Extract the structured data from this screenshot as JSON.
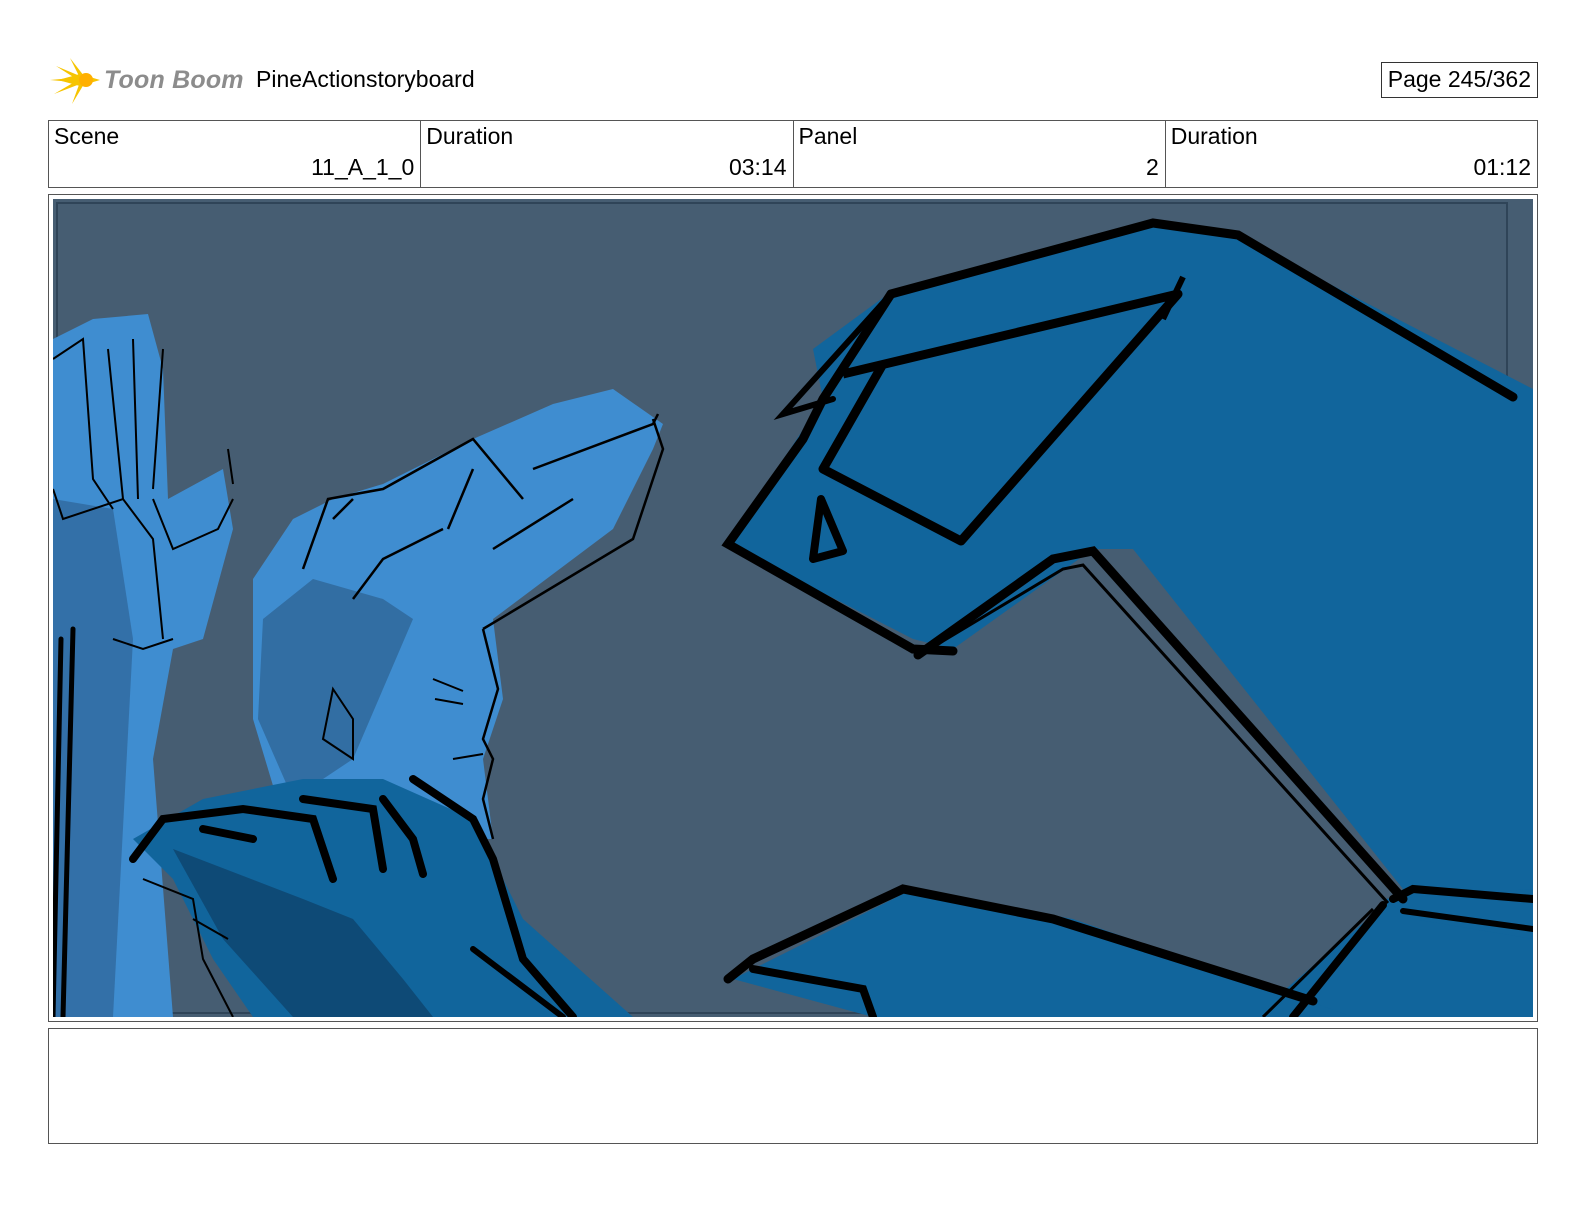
{
  "header": {
    "logo_text": "Toon Boom",
    "project_title": "PineActionstoryboard",
    "page_label": "Page 245/362"
  },
  "info": [
    {
      "label": "Scene",
      "value": "11_A_1_0"
    },
    {
      "label": "Duration",
      "value": "03:14"
    },
    {
      "label": "Panel",
      "value": "2"
    },
    {
      "label": "Duration",
      "value": "01:12"
    }
  ],
  "panel": {
    "description": "",
    "colors": {
      "background": "#465d72",
      "light_blue": "#3f8dd0",
      "dark_blue": "#11659c",
      "shadow": "#2a5a86",
      "ink": "#000000"
    }
  },
  "notes": {
    "text": ""
  }
}
